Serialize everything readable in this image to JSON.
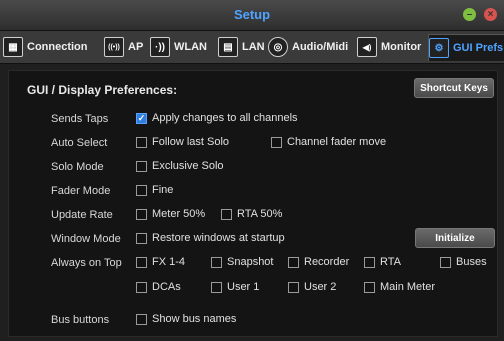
{
  "window": {
    "title": "Setup"
  },
  "tabs": [
    {
      "label": "Connection",
      "icon": "connection-icon",
      "glyph": "▦"
    },
    {
      "label": "AP",
      "icon": "access-point-icon",
      "glyph": "((•))"
    },
    {
      "label": "WLAN",
      "icon": "wlan-icon",
      "glyph": "·))"
    },
    {
      "label": "LAN",
      "icon": "lan-icon",
      "glyph": "▤"
    },
    {
      "label": "Audio/Midi",
      "icon": "audio-midi-icon",
      "glyph": "◎"
    },
    {
      "label": "Monitor",
      "icon": "monitor-icon",
      "glyph": "◀)"
    },
    {
      "label": "GUI Prefs",
      "icon": "gui-prefs-icon",
      "glyph": "⚙",
      "active": true
    }
  ],
  "panel": {
    "heading": "GUI / Display Preferences:",
    "shortcut_button": "Shortcut Keys",
    "initialize_button": "Initialize",
    "rows": {
      "sends_taps": {
        "label": "Sends Taps",
        "apply_all": {
          "text": "Apply changes to all channels",
          "checked": true
        }
      },
      "auto_select": {
        "label": "Auto Select",
        "follow_solo": {
          "text": "Follow last Solo",
          "checked": false
        },
        "fader_move": {
          "text": "Channel fader move",
          "checked": false
        }
      },
      "solo_mode": {
        "label": "Solo Mode",
        "exclusive": {
          "text": "Exclusive Solo",
          "checked": false
        }
      },
      "fader_mode": {
        "label": "Fader Mode",
        "fine": {
          "text": "Fine",
          "checked": false
        }
      },
      "update_rate": {
        "label": "Update Rate",
        "meter": {
          "text": "Meter 50%",
          "checked": false
        },
        "rta": {
          "text": "RTA 50%",
          "checked": false
        }
      },
      "window_mode": {
        "label": "Window Mode",
        "restore": {
          "text": "Restore windows at startup",
          "checked": false
        }
      },
      "always_on_top": {
        "label": "Always on Top",
        "fx": {
          "text": "FX 1-4",
          "checked": false
        },
        "snapshot": {
          "text": "Snapshot",
          "checked": false
        },
        "recorder": {
          "text": "Recorder",
          "checked": false
        },
        "rta": {
          "text": "RTA",
          "checked": false
        },
        "buses": {
          "text": "Buses",
          "checked": false
        },
        "dcas": {
          "text": "DCAs",
          "checked": false
        },
        "user1": {
          "text": "User 1",
          "checked": false
        },
        "user2": {
          "text": "User 2",
          "checked": false
        },
        "main_meter": {
          "text": "Main Meter",
          "checked": false
        }
      },
      "bus_buttons": {
        "label": "Bus buttons",
        "show_names": {
          "text": "Show bus names",
          "checked": false
        }
      }
    }
  },
  "colors": {
    "accent": "#4fa3ff",
    "checked": "#2f7fe0"
  }
}
